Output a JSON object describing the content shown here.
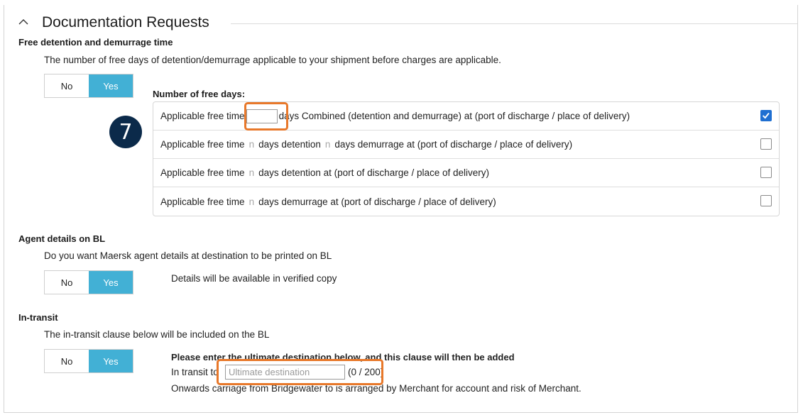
{
  "section": {
    "title": "Documentation Requests"
  },
  "free_time": {
    "heading": "Free detention and demurrage time",
    "description": "The number of free days of detention/demurrage applicable to your shipment before charges are applicable.",
    "toggle": {
      "no": "No",
      "yes": "Yes",
      "selected": "Yes"
    },
    "subheading": "Number of free days:",
    "step_marker": "7",
    "options": [
      {
        "prefix": "Applicable free time",
        "suffix": "days Combined (detention and demurrage) at (port of discharge / place of delivery)",
        "checked": true
      },
      {
        "prefix": "Applicable free time",
        "n1": "n",
        "mid": "days detention",
        "n2": "n",
        "suffix": "days demurrage at (port of discharge / place of delivery)",
        "checked": false
      },
      {
        "prefix": "Applicable free time",
        "n1": "n",
        "suffix": "days detention at (port of discharge / place of delivery)",
        "checked": false
      },
      {
        "prefix": "Applicable free time",
        "n1": "n",
        "suffix": "days demurrage at (port of discharge / place of delivery)",
        "checked": false
      }
    ]
  },
  "agent_details": {
    "heading": "Agent details on BL",
    "description": "Do you want Maersk agent details at destination to be printed on BL",
    "toggle": {
      "no": "No",
      "yes": "Yes",
      "selected": "Yes"
    },
    "note": "Details will be available in verified copy"
  },
  "in_transit": {
    "heading": "In-transit",
    "description": "The in-transit clause below will be included on the BL",
    "toggle": {
      "no": "No",
      "yes": "Yes",
      "selected": "Yes"
    },
    "instruction": "Please enter the ultimate destination below, and this clause will then be added",
    "label": "In transit to",
    "input_placeholder": "Ultimate destination",
    "counter": "(0 / 200)",
    "carriage_note": "Onwards carriage from Bridgewater to is arranged by Merchant for account and risk of Merchant."
  },
  "colors": {
    "accent": "#42b0d5",
    "highlight": "#e8782a",
    "checkbox": "#1f6fd1",
    "marker": "#0b2a4a"
  }
}
